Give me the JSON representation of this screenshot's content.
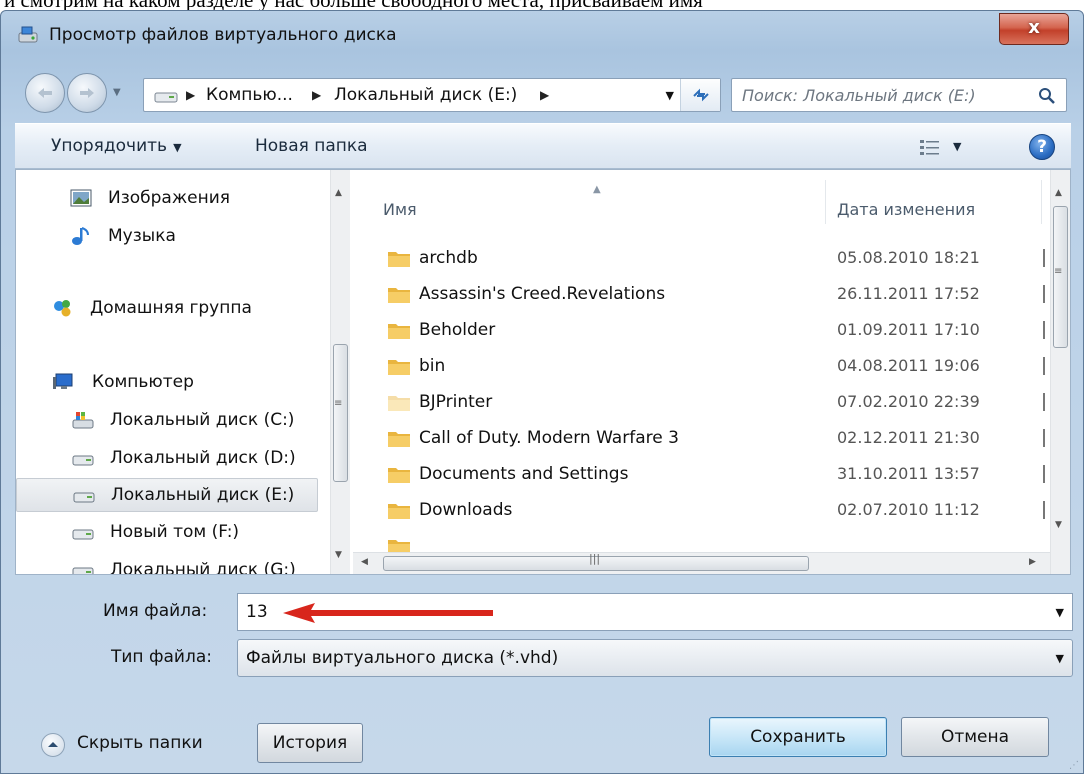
{
  "caption": "и смотрим на каком разделе у нас больше свободного места, присваиваем имя",
  "window": {
    "title": "Просмотр файлов виртуального диска",
    "close_label": "x"
  },
  "address": {
    "crumbs": [
      "Компью...",
      "Локальный диск (E:)"
    ],
    "search_placeholder": "Поиск: Локальный диск (E:)"
  },
  "toolbar": {
    "organize_label": "Упорядочить",
    "new_folder_label": "Новая папка",
    "help_label": "?"
  },
  "nav_pane": {
    "items": [
      {
        "label": "Изображения",
        "icon": "pictures-icon"
      },
      {
        "label": "Музыка",
        "icon": "music-icon"
      },
      {
        "label": "Домашняя группа",
        "icon": "homegroup-icon"
      },
      {
        "label": "Компьютер",
        "icon": "computer-icon"
      },
      {
        "label": "Локальный диск (C:)",
        "icon": "system-drive-icon"
      },
      {
        "label": "Локальный диск (D:)",
        "icon": "drive-icon"
      },
      {
        "label": "Локальный диск (E:)",
        "icon": "drive-icon",
        "selected": true
      },
      {
        "label": "Новый том (F:)",
        "icon": "drive-icon"
      },
      {
        "label": "Локальный диск (G:)",
        "icon": "drive-icon"
      }
    ]
  },
  "file_list": {
    "columns": {
      "name": "Имя",
      "date": "Дата изменения"
    },
    "rows": [
      {
        "name": "archdb",
        "date": "05.08.2010 18:21"
      },
      {
        "name": "Assassin's Creed.Revelations",
        "date": "26.11.2011 17:52"
      },
      {
        "name": "Beholder",
        "date": "01.09.2011 17:10"
      },
      {
        "name": "bin",
        "date": "04.08.2011 19:06"
      },
      {
        "name": "BJPrinter",
        "date": "07.02.2010 22:39"
      },
      {
        "name": "Call of Duty. Modern Warfare 3",
        "date": "02.12.2011 21:30"
      },
      {
        "name": "Documents and Settings",
        "date": "31.10.2011 13:57"
      },
      {
        "name": "Downloads",
        "date": "02.07.2010 11:12"
      }
    ]
  },
  "form": {
    "filename_label": "Имя файла:",
    "filename_value": "13",
    "filetype_label": "Тип файла:",
    "filetype_value": "Файлы виртуального диска (*.vhd)",
    "hide_folders_label": "Скрыть папки",
    "history_label": "История",
    "save_label": "Сохранить",
    "cancel_label": "Отмена"
  },
  "colors": {
    "accent_blue": "#3c7fb1",
    "close_red": "#c2402a",
    "annotation_red": "#d8261c"
  }
}
